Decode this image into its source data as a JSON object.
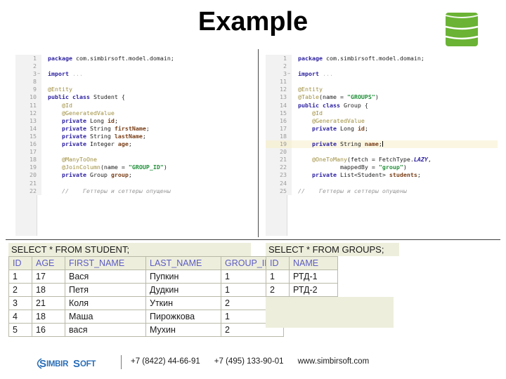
{
  "title": "Example",
  "icons": {
    "database": "database-cylinder-icon",
    "logo": "simbirsoft-logo"
  },
  "colors": {
    "db_green": "#6ab334",
    "logo_blue": "#2a6eb8",
    "table_header_text": "#5c5cc4",
    "table_header_bg": "#eeeedd",
    "keyword": "#2b1fa0",
    "annotation": "#a09040",
    "string": "#22903a",
    "field": "#7a3f18",
    "comment": "#9a9a9a"
  },
  "code_left": {
    "lines": [
      {
        "n": "1",
        "tokens": [
          {
            "t": "package ",
            "c": "kw"
          },
          {
            "t": "com.simbirsoft.model.domain;",
            "c": "plain"
          }
        ],
        "indent": 0
      },
      {
        "n": "2",
        "tokens": [],
        "indent": 0
      },
      {
        "n": "3",
        "tokens": [
          {
            "t": "import ",
            "c": "kw"
          },
          {
            "t": "...",
            "c": "dots"
          }
        ],
        "indent": 0,
        "fold": true
      },
      {
        "n": "8",
        "tokens": [],
        "indent": 0
      },
      {
        "n": "9",
        "tokens": [
          {
            "t": "@Entity",
            "c": "ann"
          }
        ],
        "indent": 0
      },
      {
        "n": "10",
        "tokens": [
          {
            "t": "public class ",
            "c": "kw"
          },
          {
            "t": "Student {",
            "c": "plain"
          }
        ],
        "indent": 0
      },
      {
        "n": "11",
        "tokens": [
          {
            "t": "@Id",
            "c": "ann"
          }
        ],
        "indent": 1
      },
      {
        "n": "12",
        "tokens": [
          {
            "t": "@GeneratedValue",
            "c": "ann"
          }
        ],
        "indent": 1
      },
      {
        "n": "13",
        "tokens": [
          {
            "t": "private ",
            "c": "kw"
          },
          {
            "t": "Long ",
            "c": "plain"
          },
          {
            "t": "id",
            "c": "fld"
          },
          {
            "t": ";",
            "c": "plain"
          }
        ],
        "indent": 1
      },
      {
        "n": "14",
        "tokens": [
          {
            "t": "private ",
            "c": "kw"
          },
          {
            "t": "String ",
            "c": "plain"
          },
          {
            "t": "firstName",
            "c": "fld"
          },
          {
            "t": ";",
            "c": "plain"
          }
        ],
        "indent": 1
      },
      {
        "n": "15",
        "tokens": [
          {
            "t": "private ",
            "c": "kw"
          },
          {
            "t": "String ",
            "c": "plain"
          },
          {
            "t": "lastName",
            "c": "fld"
          },
          {
            "t": ";",
            "c": "plain"
          }
        ],
        "indent": 1
      },
      {
        "n": "16",
        "tokens": [
          {
            "t": "private ",
            "c": "kw"
          },
          {
            "t": "Integer ",
            "c": "plain"
          },
          {
            "t": "age",
            "c": "fld"
          },
          {
            "t": ";",
            "c": "plain"
          }
        ],
        "indent": 1
      },
      {
        "n": "17",
        "tokens": [],
        "indent": 0
      },
      {
        "n": "18",
        "tokens": [
          {
            "t": "@ManyToOne",
            "c": "ann"
          }
        ],
        "indent": 1
      },
      {
        "n": "19",
        "tokens": [
          {
            "t": "@JoinColumn",
            "c": "ann"
          },
          {
            "t": "(name = ",
            "c": "plain"
          },
          {
            "t": "\"GROUP_ID\"",
            "c": "str"
          },
          {
            "t": ")",
            "c": "plain"
          }
        ],
        "indent": 1
      },
      {
        "n": "20",
        "tokens": [
          {
            "t": "private ",
            "c": "kw"
          },
          {
            "t": "Group ",
            "c": "plain"
          },
          {
            "t": "group",
            "c": "fld"
          },
          {
            "t": ";",
            "c": "plain"
          }
        ],
        "indent": 1
      },
      {
        "n": "21",
        "tokens": [],
        "indent": 0
      },
      {
        "n": "22",
        "tokens": [
          {
            "t": "//    Геттеры и сеттеры опущены",
            "c": "cmt"
          }
        ],
        "indent": 1
      }
    ]
  },
  "code_right": {
    "lines": [
      {
        "n": "1",
        "tokens": [
          {
            "t": "package ",
            "c": "kw"
          },
          {
            "t": "com.simbirsoft.model.domain;",
            "c": "plain"
          }
        ],
        "indent": 0
      },
      {
        "n": "2",
        "tokens": [],
        "indent": 0
      },
      {
        "n": "3",
        "tokens": [
          {
            "t": "import ",
            "c": "kw"
          },
          {
            "t": "...",
            "c": "dots"
          }
        ],
        "indent": 0,
        "fold": true
      },
      {
        "n": "11",
        "tokens": [],
        "indent": 0
      },
      {
        "n": "12",
        "tokens": [
          {
            "t": "@Entity",
            "c": "ann"
          }
        ],
        "indent": 0
      },
      {
        "n": "13",
        "tokens": [
          {
            "t": "@Table",
            "c": "ann"
          },
          {
            "t": "(name = ",
            "c": "plain"
          },
          {
            "t": "\"GROUPS\"",
            "c": "str"
          },
          {
            "t": ")",
            "c": "plain"
          }
        ],
        "indent": 0
      },
      {
        "n": "14",
        "tokens": [
          {
            "t": "public class ",
            "c": "kw"
          },
          {
            "t": "Group {",
            "c": "plain"
          }
        ],
        "indent": 0
      },
      {
        "n": "15",
        "tokens": [
          {
            "t": "@Id",
            "c": "ann"
          }
        ],
        "indent": 1
      },
      {
        "n": "16",
        "tokens": [
          {
            "t": "@GeneratedValue",
            "c": "ann"
          }
        ],
        "indent": 1
      },
      {
        "n": "17",
        "tokens": [
          {
            "t": "private ",
            "c": "kw"
          },
          {
            "t": "Long ",
            "c": "plain"
          },
          {
            "t": "id",
            "c": "fld"
          },
          {
            "t": ";",
            "c": "plain"
          }
        ],
        "indent": 1
      },
      {
        "n": "18",
        "tokens": [],
        "indent": 0
      },
      {
        "n": "19",
        "tokens": [
          {
            "t": "private ",
            "c": "kw"
          },
          {
            "t": "String ",
            "c": "plain"
          },
          {
            "t": "name",
            "c": "fld"
          },
          {
            "t": ";",
            "c": "plain"
          }
        ],
        "indent": 1,
        "highlight": true,
        "caret": true
      },
      {
        "n": "20",
        "tokens": [],
        "indent": 0
      },
      {
        "n": "21",
        "tokens": [
          {
            "t": "@OneToMany",
            "c": "ann"
          },
          {
            "t": "(fetch = FetchType.",
            "c": "plain"
          },
          {
            "t": "LAZY",
            "c": "ita"
          },
          {
            "t": ",",
            "c": "plain"
          }
        ],
        "indent": 1
      },
      {
        "n": "22",
        "tokens": [
          {
            "t": "        mappedBy = ",
            "c": "plain"
          },
          {
            "t": "\"group\"",
            "c": "str"
          },
          {
            "t": ")",
            "c": "plain"
          }
        ],
        "indent": 1
      },
      {
        "n": "23",
        "tokens": [
          {
            "t": "private ",
            "c": "kw"
          },
          {
            "t": "List<Student> ",
            "c": "plain"
          },
          {
            "t": "students",
            "c": "fld"
          },
          {
            "t": ";",
            "c": "plain"
          }
        ],
        "indent": 1
      },
      {
        "n": "24",
        "tokens": [],
        "indent": 0
      },
      {
        "n": "25",
        "tokens": [
          {
            "t": "//    Геттеры и сеттеры опущены",
            "c": "cmt"
          }
        ],
        "indent": 0
      }
    ]
  },
  "result_left": {
    "query": "SELECT * FROM STUDENT;",
    "columns": [
      "ID",
      "AGE",
      "FIRST_NAME",
      "LAST_NAME",
      "GROUP_ID"
    ],
    "rows": [
      [
        "1",
        "17",
        "Вася",
        "Пупкин",
        "1"
      ],
      [
        "2",
        "18",
        "Петя",
        "Дудкин",
        "1"
      ],
      [
        "3",
        "21",
        "Коля",
        "Уткин",
        "2"
      ],
      [
        "4",
        "18",
        "Маша",
        "Пирожкова",
        "1"
      ],
      [
        "5",
        "16",
        "вася",
        "Мухин",
        "2"
      ]
    ]
  },
  "result_right": {
    "query": "SELECT * FROM GROUPS;",
    "columns": [
      "ID",
      "NAME"
    ],
    "rows": [
      [
        "1",
        "РТД-1"
      ],
      [
        "2",
        "РТД-2"
      ]
    ]
  },
  "footer": {
    "logo_text": "SimbirSoft",
    "contacts": [
      "+7 (8422) 44-66-91",
      "+7 (495) 133-90-01",
      "www.simbirsoft.com"
    ]
  }
}
